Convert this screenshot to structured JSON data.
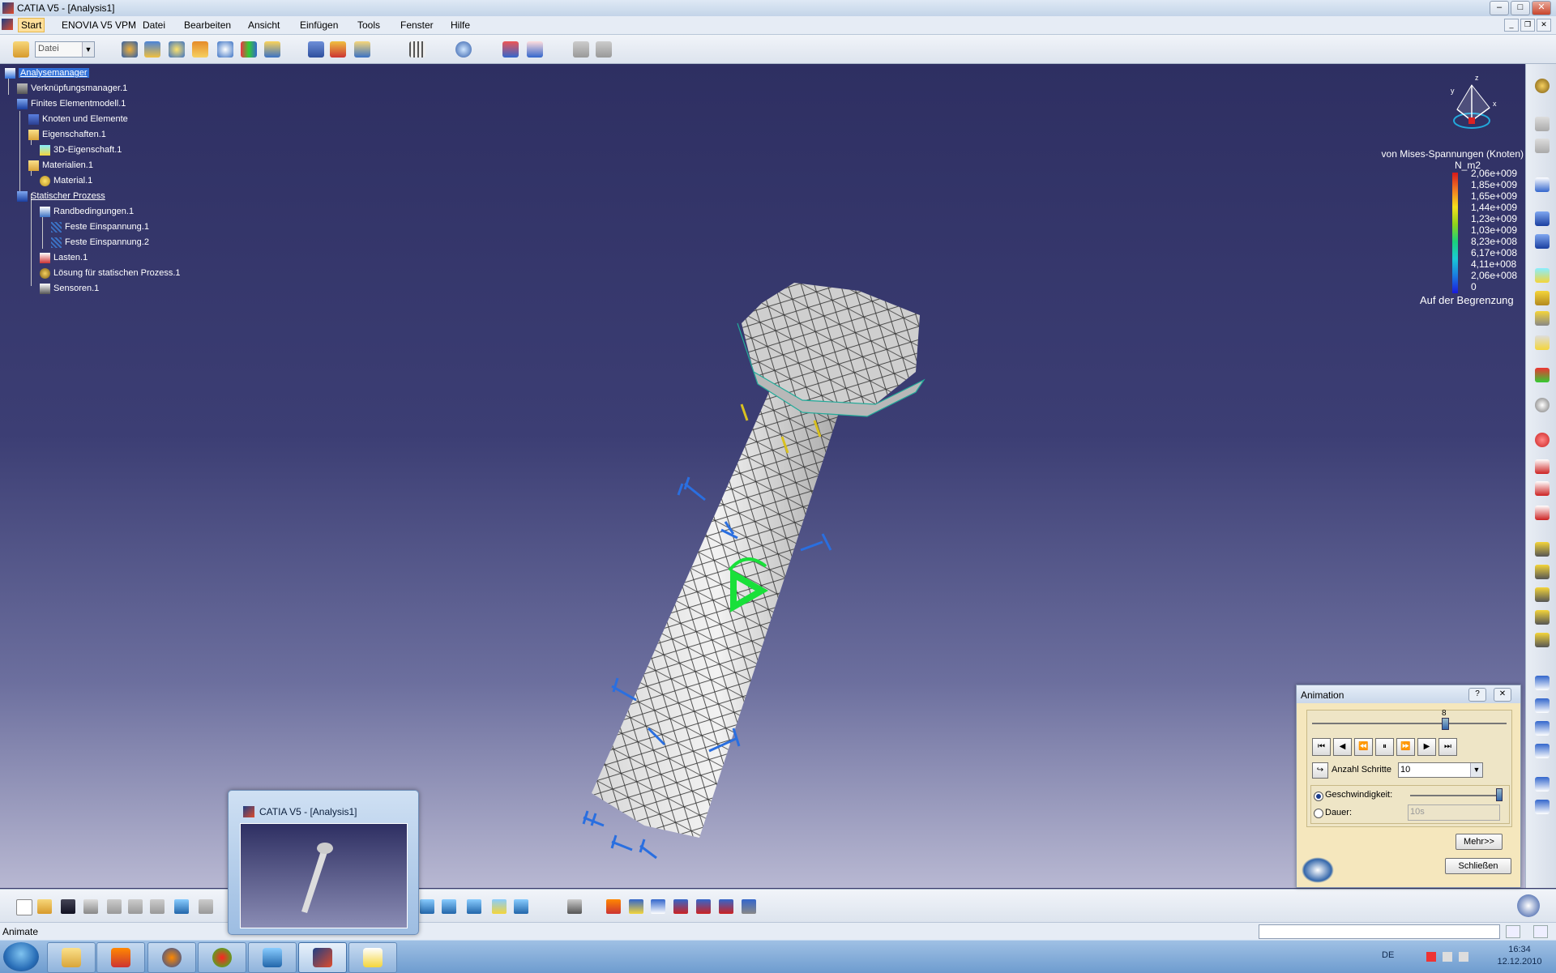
{
  "window": {
    "title": "CATIA V5 - [Analysis1]",
    "controls": [
      "–",
      "□",
      "✕"
    ],
    "mdi_controls": [
      "_",
      "❐",
      "✕"
    ]
  },
  "menu": {
    "items": [
      "Start",
      "ENOVIA V5 VPM",
      "Datei",
      "Bearbeiten",
      "Ansicht",
      "Einfügen",
      "Tools",
      "Fenster",
      "Hilfe"
    ]
  },
  "toolbar": {
    "combo_value": "Datei"
  },
  "tree": {
    "nodes": [
      {
        "label": "Analysemanager"
      },
      {
        "label": "Verknüpfungsmanager.1"
      },
      {
        "label": "Finites Elementmodell.1"
      },
      {
        "label": "Knoten und Elemente"
      },
      {
        "label": "Eigenschaften.1"
      },
      {
        "label": "3D-Eigenschaft.1"
      },
      {
        "label": "Materialien.1"
      },
      {
        "label": "Material.1"
      },
      {
        "label": "Statischer Prozess"
      },
      {
        "label": "Randbedingungen.1"
      },
      {
        "label": "Feste Einspannung.1"
      },
      {
        "label": "Feste Einspannung.2"
      },
      {
        "label": "Lasten.1"
      },
      {
        "label": "Lösung für statischen Prozess.1"
      },
      {
        "label": "Sensoren.1"
      }
    ]
  },
  "legend": {
    "title": "von Mises-Spannungen (Knoten)",
    "unit": "N_m2",
    "values": [
      "2,06e+009",
      "1,85e+009",
      "1,65e+009",
      "1,44e+009",
      "1,23e+009",
      "1,03e+009",
      "8,23e+008",
      "6,17e+008",
      "4,11e+008",
      "2,06e+008",
      "0"
    ],
    "footer": "Auf der Begrenzung",
    "colors": [
      "#d7191c",
      "#f17a22",
      "#f5e01c",
      "#8fd21a",
      "#1bd17a",
      "#19c9d5",
      "#1a7ae0",
      "#1a1adc"
    ]
  },
  "compass": {
    "axes": [
      "z",
      "y",
      "x"
    ]
  },
  "animation": {
    "title": "Animation",
    "help": "?",
    "close": "✕",
    "slider_value": "8",
    "steps_label": "Anzahl Schritte",
    "steps_value": "10",
    "speed_label": "Geschwindigkeit:",
    "duration_label": "Dauer:",
    "duration_value": "10s",
    "more_button": "Mehr>>",
    "close_button": "Schließen"
  },
  "thumbnail": {
    "title": "CATIA V5 - [Analysis1]"
  },
  "status": {
    "text": "Animate"
  },
  "taskbar": {
    "lang": "DE",
    "time": "16:34",
    "date": "12.12.2010"
  }
}
